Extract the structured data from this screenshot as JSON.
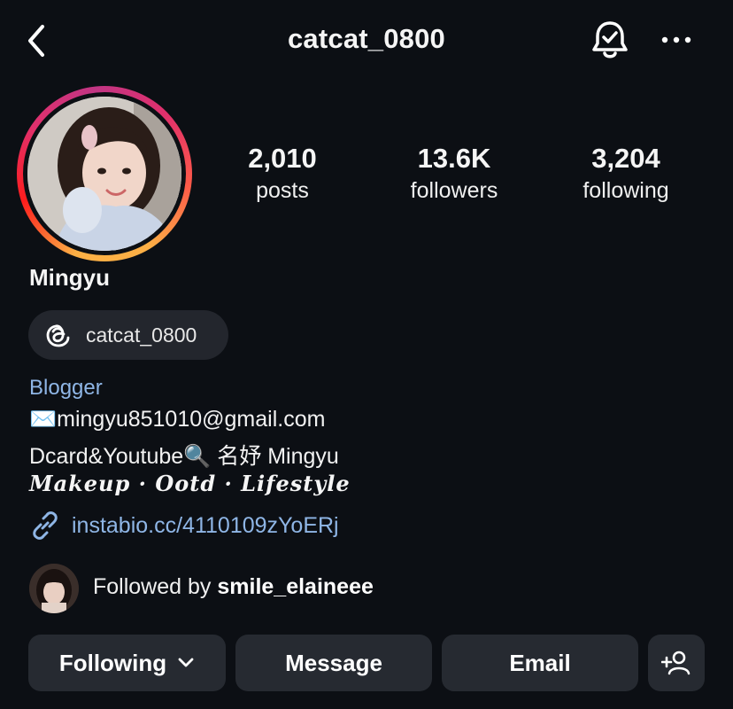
{
  "header": {
    "title": "catcat_0800"
  },
  "profile": {
    "name": "Mingyu"
  },
  "stats": [
    {
      "num": "2,010",
      "label": "posts"
    },
    {
      "num": "13.6K",
      "label": "followers"
    },
    {
      "num": "3,204",
      "label": "following"
    }
  ],
  "threads": {
    "handle": "catcat_0800"
  },
  "bio": {
    "category": "Blogger",
    "email_line": "✉️mingyu851010@gmail.com",
    "channels_line": "Dcard&Youtube🔍 名妤 Mingyu",
    "style_line": "Makeup · Ootd · Lifestyle",
    "link": "instabio.cc/4110109zYoERj"
  },
  "followed_by": {
    "prefix": "Followed by ",
    "user": "smile_elaineee"
  },
  "actions": {
    "following": "Following",
    "message": "Message",
    "email": "Email"
  },
  "colors": {
    "background": "#0c0f14",
    "button": "#262a31",
    "link": "#8fb6e6"
  },
  "icons": [
    "back-chevron-icon",
    "notification-bell-icon",
    "more-options-icon",
    "threads-icon",
    "link-icon",
    "add-person-icon"
  ]
}
